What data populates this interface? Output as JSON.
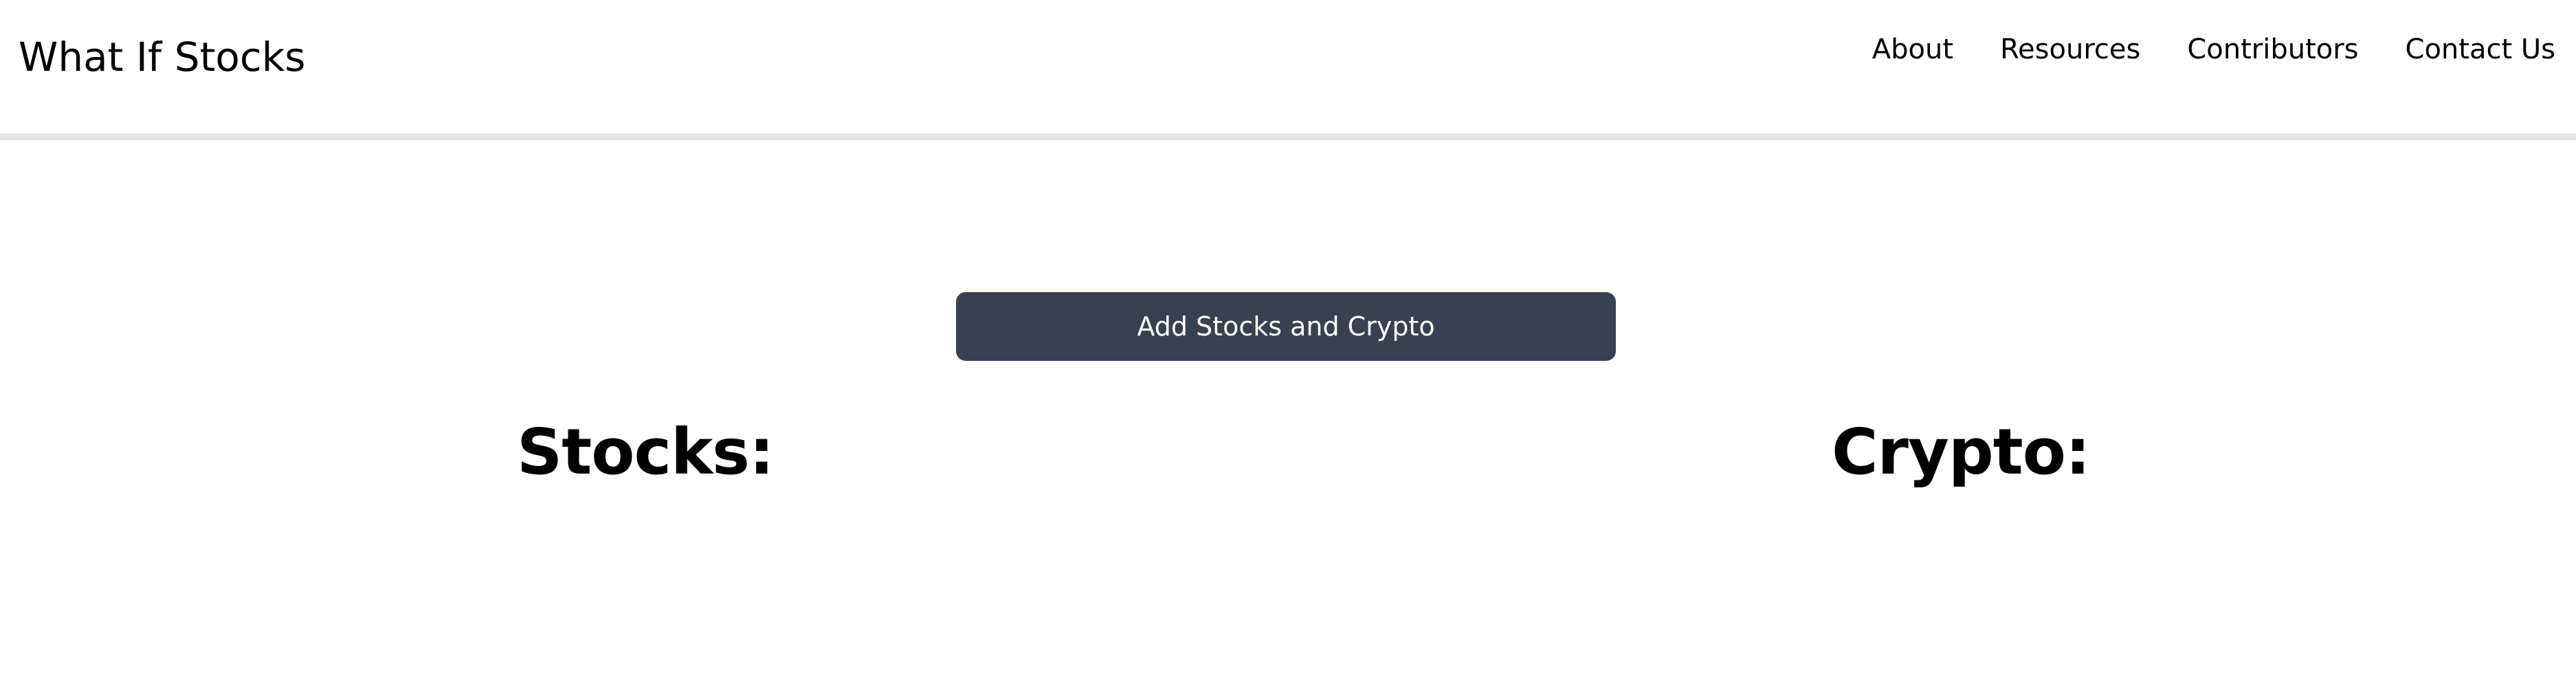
{
  "nav": {
    "brand": "What If Stocks",
    "links": [
      {
        "label": "About"
      },
      {
        "label": "Resources"
      },
      {
        "label": "Contributors"
      },
      {
        "label": "Contact Us"
      }
    ]
  },
  "main": {
    "add_button_label": "Add Stocks and Crypto",
    "stocks_heading": "Stocks:",
    "crypto_heading": "Crypto:"
  },
  "colors": {
    "button_bg": "#374151",
    "button_text": "#ffffff",
    "navbar_border": "#e5e5e5"
  }
}
